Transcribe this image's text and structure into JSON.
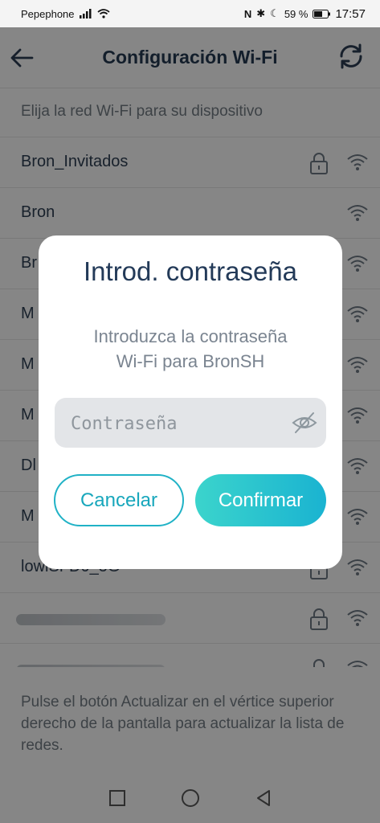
{
  "status_bar": {
    "carrier": "Pepephone",
    "battery": "59 %",
    "time": "17:57"
  },
  "header": {
    "title": "Configuración Wi-Fi"
  },
  "subtitle": "Elija la red Wi-Fi para su dispositivo",
  "networks": [
    {
      "name": "Bron_Invitados",
      "locked": true
    },
    {
      "name": "Bron",
      "locked": false
    },
    {
      "name": "Br",
      "locked": false
    },
    {
      "name": "M",
      "locked": false
    },
    {
      "name": "M",
      "locked": false
    },
    {
      "name": "M",
      "locked": false
    },
    {
      "name": "Dl",
      "locked": false
    },
    {
      "name": "M",
      "locked": false
    },
    {
      "name": "lowiSFD0_5G",
      "locked": true
    },
    {
      "name": "",
      "locked": true
    },
    {
      "name": "",
      "locked": true
    }
  ],
  "footer_note": "Pulse el botón Actualizar en el vértice superior derecho de la pantalla para actualizar la lista de redes.",
  "dialog": {
    "title": "Introd. contraseña",
    "message_line1": "Introduzca la contraseña",
    "message_line2": "Wi-Fi para BronSH",
    "password_placeholder": "Contraseña",
    "cancel_label": "Cancelar",
    "confirm_label": "Confirmar"
  },
  "icons": {
    "back": "arrow-left-icon",
    "refresh": "refresh-icon",
    "lock": "lock-icon",
    "wifi": "wifi-icon",
    "eye": "eye-slash-icon"
  },
  "colors": {
    "accent": "#1ab3d1",
    "accent_light": "#3bd4cc",
    "title": "#24384f"
  }
}
